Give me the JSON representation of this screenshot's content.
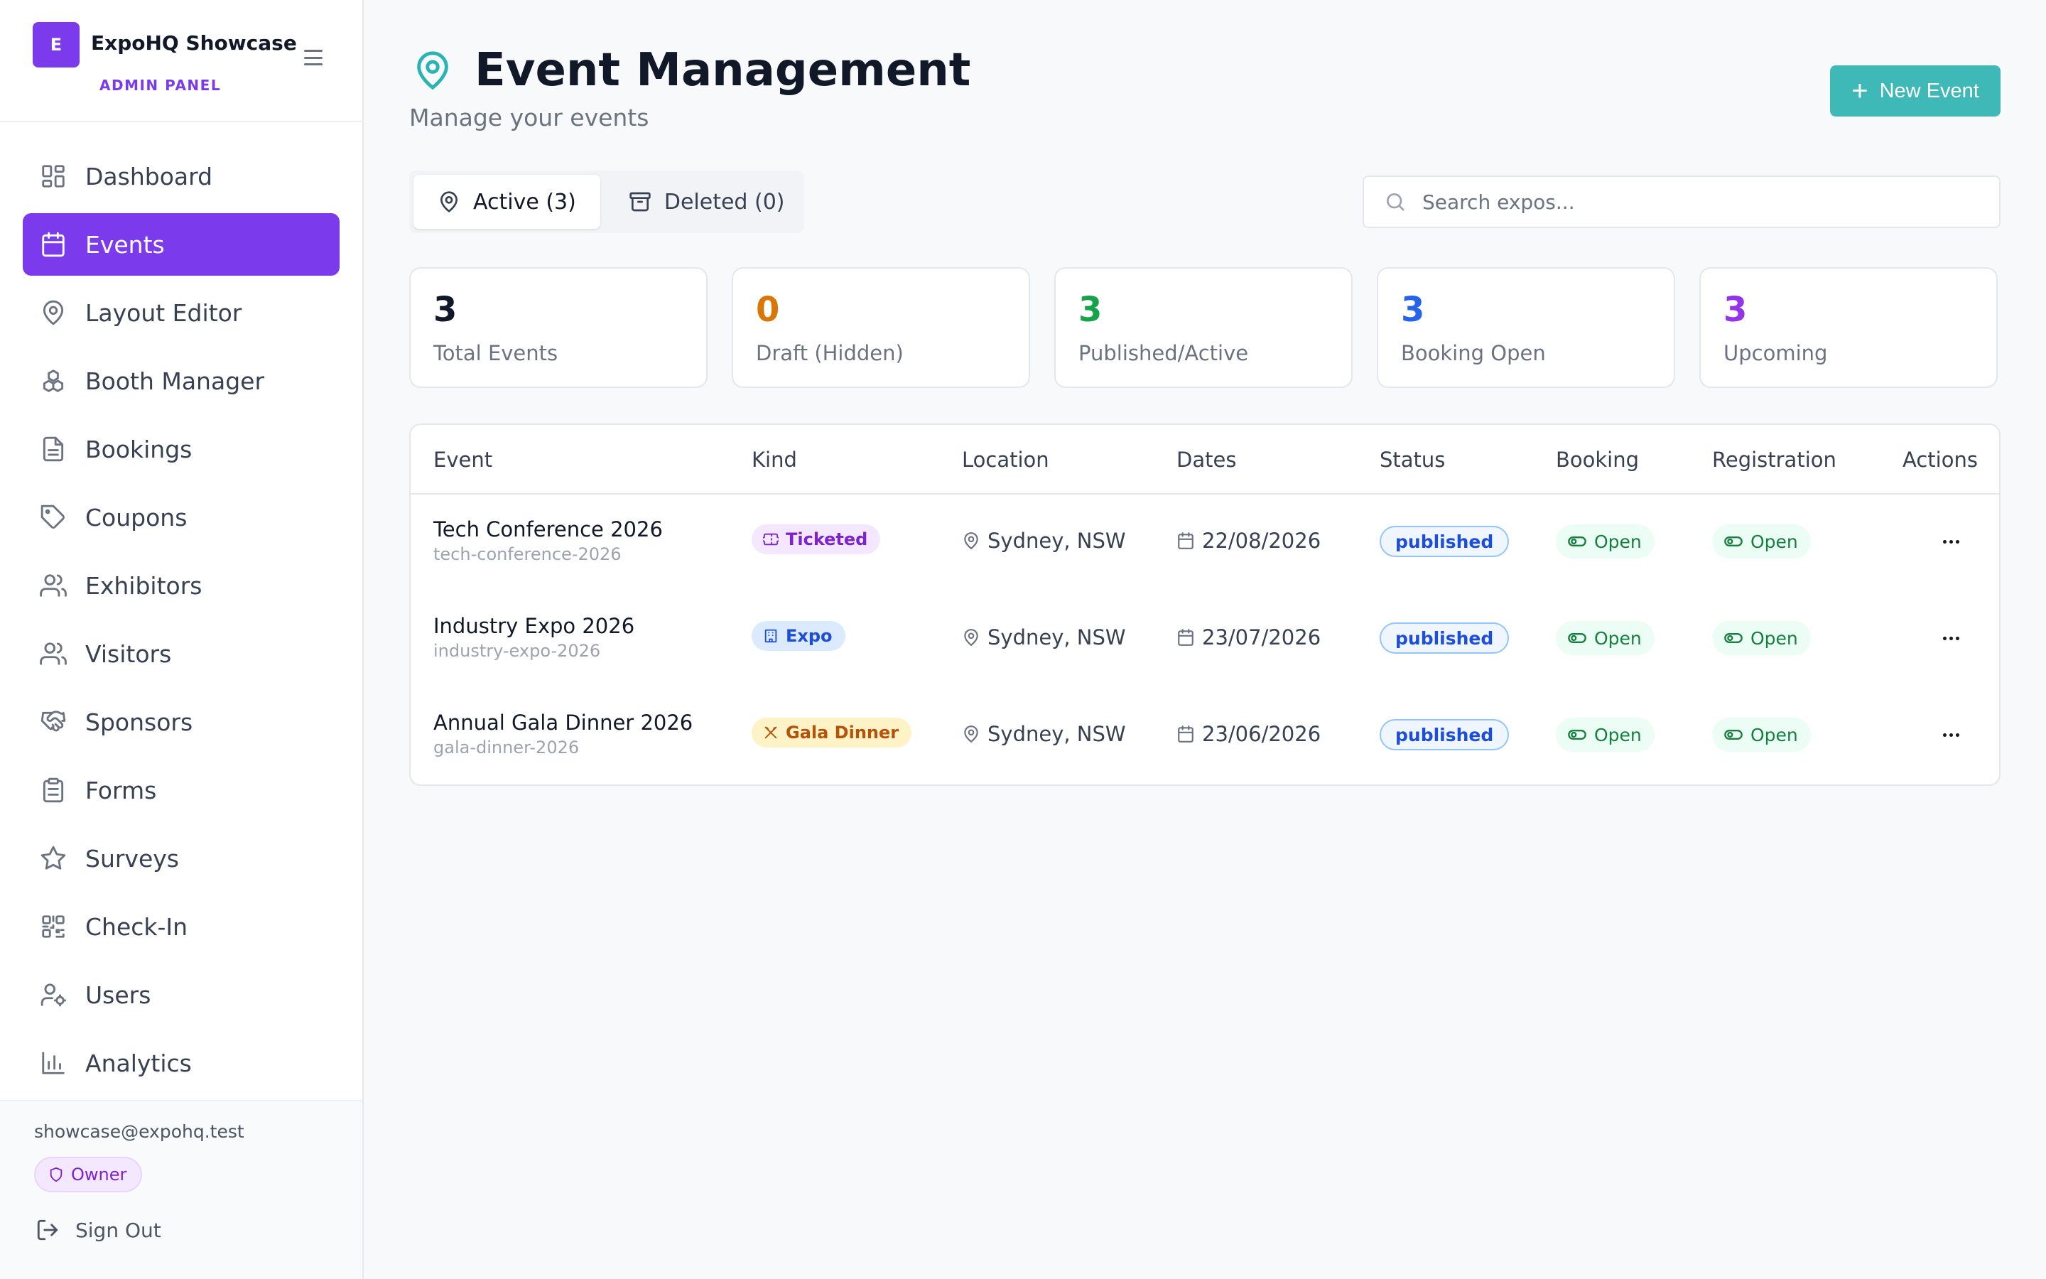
{
  "brand": {
    "logo_letter": "E",
    "name": "ExpoHQ Showcase",
    "subtitle": "ADMIN PANEL"
  },
  "sidebar": {
    "items": [
      {
        "label": "Dashboard",
        "icon": "dashboard-icon"
      },
      {
        "label": "Events",
        "icon": "calendar-icon",
        "active": true
      },
      {
        "label": "Layout Editor",
        "icon": "map-pin-icon"
      },
      {
        "label": "Booth Manager",
        "icon": "boxes-icon"
      },
      {
        "label": "Bookings",
        "icon": "file-text-icon"
      },
      {
        "label": "Coupons",
        "icon": "tag-icon"
      },
      {
        "label": "Exhibitors",
        "icon": "users-icon"
      },
      {
        "label": "Visitors",
        "icon": "users-icon"
      },
      {
        "label": "Sponsors",
        "icon": "handshake-icon"
      },
      {
        "label": "Forms",
        "icon": "clipboard-icon"
      },
      {
        "label": "Surveys",
        "icon": "star-icon"
      },
      {
        "label": "Check-In",
        "icon": "qr-code-icon"
      },
      {
        "label": "Users",
        "icon": "user-cog-icon"
      },
      {
        "label": "Analytics",
        "icon": "bar-chart-icon"
      }
    ],
    "footer": {
      "email": "showcase@expohq.test",
      "role": "Owner",
      "signout": "Sign Out"
    }
  },
  "header": {
    "title": "Event Management",
    "subtitle": "Manage your events",
    "new_button": "New Event"
  },
  "tabs": [
    {
      "label": "Active (3)",
      "active": true
    },
    {
      "label": "Deleted (0)",
      "active": false
    }
  ],
  "search": {
    "placeholder": "Search expos...",
    "value": ""
  },
  "stats": [
    {
      "value": "3",
      "label": "Total Events",
      "color": "#111827"
    },
    {
      "value": "0",
      "label": "Draft (Hidden)",
      "color": "#d97706"
    },
    {
      "value": "3",
      "label": "Published/Active",
      "color": "#16a34a"
    },
    {
      "value": "3",
      "label": "Booking Open",
      "color": "#2563eb"
    },
    {
      "value": "3",
      "label": "Upcoming",
      "color": "#9333ea"
    }
  ],
  "table": {
    "columns": [
      "Event",
      "Kind",
      "Location",
      "Dates",
      "Status",
      "Booking",
      "Registration",
      "Actions"
    ],
    "rows": [
      {
        "name": "Tech Conference 2026",
        "slug": "tech-conference-2026",
        "kind": "Ticketed",
        "kind_color": "#7e22ce",
        "kind_bg": "#f3e8ff",
        "location": "Sydney, NSW",
        "date": "22/08/2026",
        "status": "published",
        "booking": "Open",
        "registration": "Open"
      },
      {
        "name": "Industry Expo 2026",
        "slug": "industry-expo-2026",
        "kind": "Expo",
        "kind_color": "#1d4ed8",
        "kind_bg": "#dbeafe",
        "location": "Sydney, NSW",
        "date": "23/07/2026",
        "status": "published",
        "booking": "Open",
        "registration": "Open"
      },
      {
        "name": "Annual Gala Dinner 2026",
        "slug": "gala-dinner-2026",
        "kind": "Gala Dinner",
        "kind_color": "#b45309",
        "kind_bg": "#fef3c7",
        "location": "Sydney, NSW",
        "date": "23/06/2026",
        "status": "published",
        "booking": "Open",
        "registration": "Open"
      }
    ]
  }
}
